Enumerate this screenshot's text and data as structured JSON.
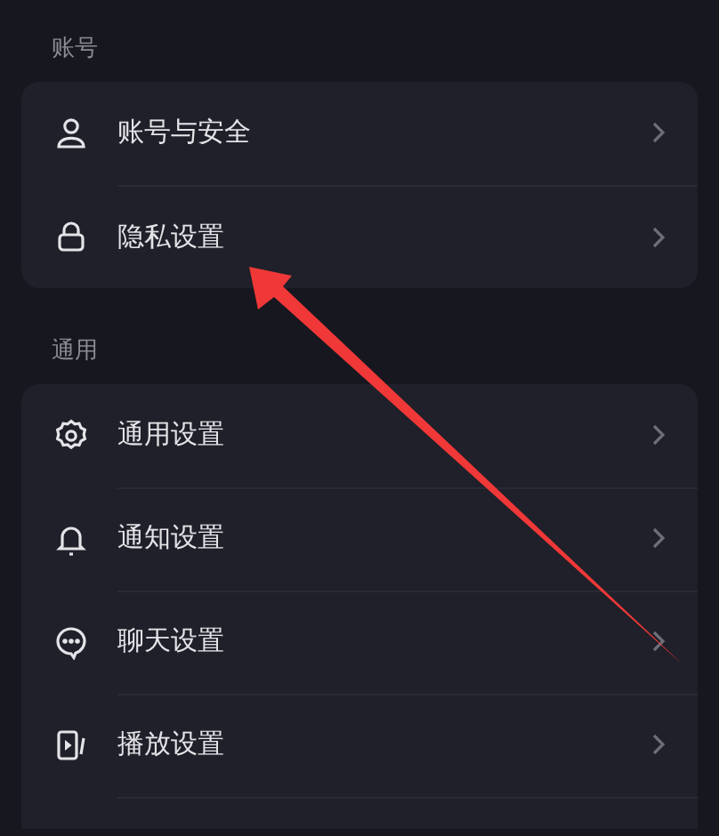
{
  "sections": [
    {
      "title": "账号",
      "items": [
        {
          "label": "账号与安全"
        },
        {
          "label": "隐私设置"
        }
      ]
    },
    {
      "title": "通用",
      "items": [
        {
          "label": "通用设置"
        },
        {
          "label": "通知设置"
        },
        {
          "label": "聊天设置"
        },
        {
          "label": "播放设置"
        }
      ]
    }
  ]
}
